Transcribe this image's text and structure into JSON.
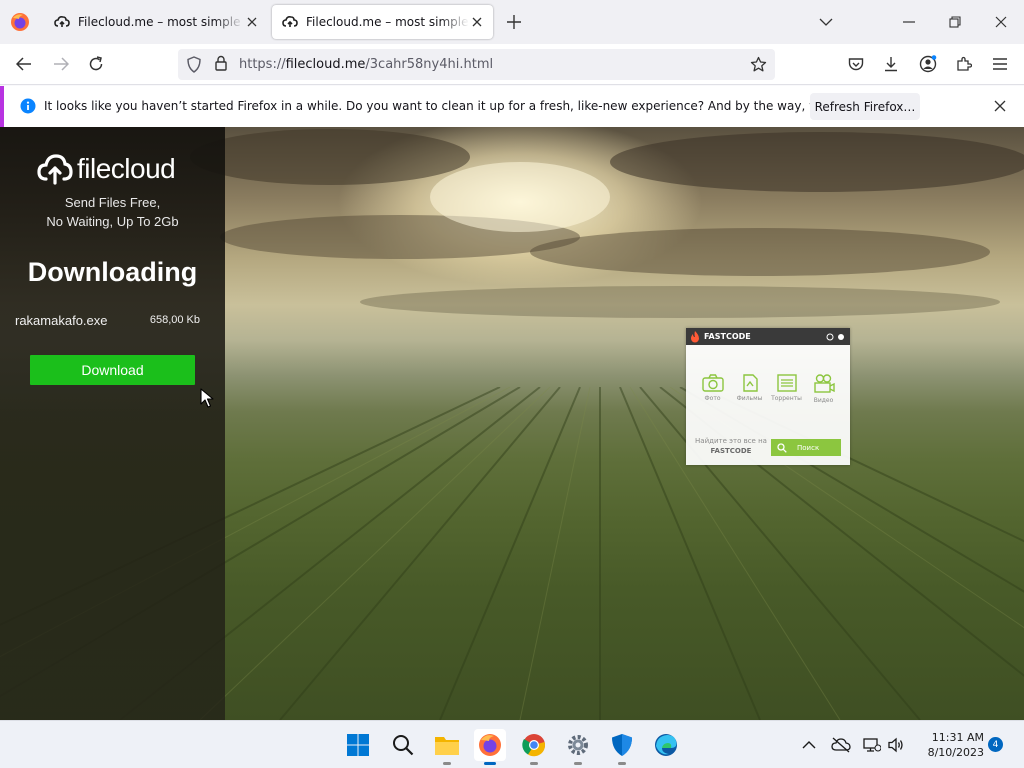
{
  "browser": {
    "tabs": [
      {
        "title": "Filecloud.me – most simple file sharing",
        "active": false
      },
      {
        "title": "Filecloud.me – most simple file sharing",
        "active": true
      }
    ],
    "url": {
      "scheme": "https://",
      "host": "filecloud.me",
      "path": "/3cahr58ny4hi.html"
    },
    "notification": {
      "text": "It looks like you haven’t started Firefox in a while. Do you want to clean it up for a fresh, like-new experience? And by the way, welcome back!",
      "button": "Refresh Firefox…"
    }
  },
  "page": {
    "logo": "filecloud",
    "tagline_line1": "Send Files Free,",
    "tagline_line2": "No Waiting, Up To 2Gb",
    "heading": "Downloading",
    "file_name": "rakamakafo.exe",
    "file_size": "658,00 Kb",
    "download_button": "Download",
    "ad_widget": {
      "brand": "FASTCODE",
      "items": [
        "Фото",
        "Фильмы",
        "Торренты",
        "Видео"
      ],
      "prompt_line1": "Найдите это все на",
      "prompt_line2": "FASTCODE",
      "search_button": "Поиск"
    }
  },
  "taskbar": {
    "apps": [
      "start",
      "search",
      "file-explorer",
      "firefox",
      "chrome",
      "settings",
      "windows-security",
      "edge"
    ],
    "active_app": "firefox",
    "time": "11:31 AM",
    "date": "8/10/2023",
    "notification_count": "4"
  },
  "colors": {
    "download_green": "#1bbf1b",
    "notification_accent": "#b833e1",
    "widget_green": "#8cc63f",
    "taskbar_accent": "#0067c0"
  }
}
